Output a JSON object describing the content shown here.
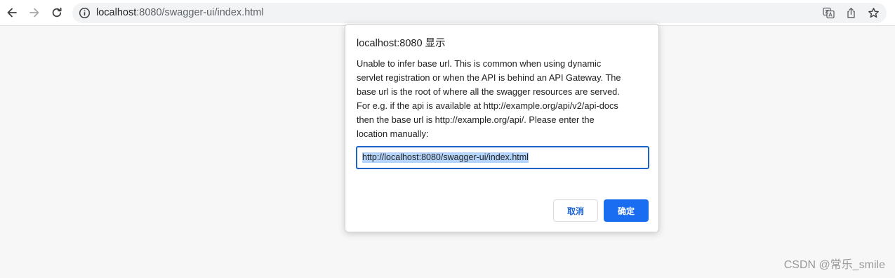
{
  "browser": {
    "url_host": "localhost",
    "url_path": ":8080/swagger-ui/index.html",
    "icons": {
      "back": "back-arrow-icon",
      "forward": "forward-arrow-icon",
      "reload": "reload-icon",
      "site_info": "info-icon",
      "translate": "translate-icon",
      "share": "share-icon",
      "bookmark": "star-icon"
    }
  },
  "dialog": {
    "title": "localhost:8080 显示",
    "message_lines": [
      "Unable to infer base url. This is common when using dynamic",
      "servlet registration or when the API is behind an API Gateway. The",
      "base url is the root of where all the swagger resources are served.",
      "For e.g. if the api is available at http://example.org/api/v2/api-docs",
      "then the base url is http://example.org/api/. Please enter the",
      "location manually:"
    ],
    "input_value": "http://localhost:8080/swagger-ui/index.html",
    "cancel_label": "取消",
    "ok_label": "确定"
  },
  "watermark": "CSDN @常乐_smile",
  "colors": {
    "accent": "#1a6df0",
    "selection": "#b4d4fb",
    "page_background": "#f7f7f7"
  }
}
